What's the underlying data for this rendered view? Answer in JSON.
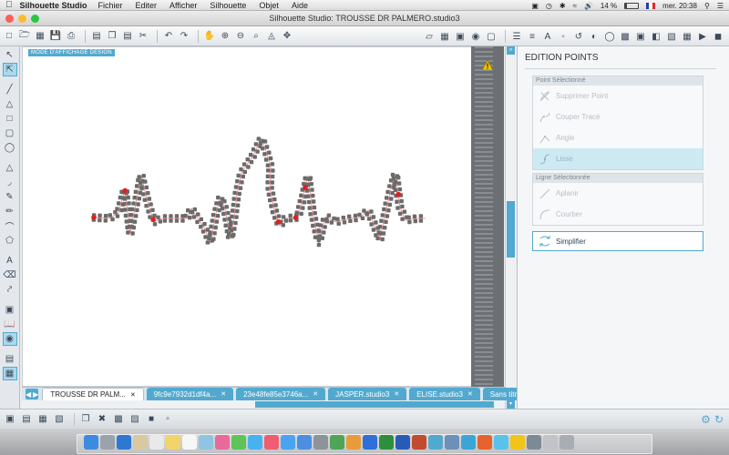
{
  "menubar": {
    "app": "Silhouette Studio",
    "menus": [
      "Fichier",
      "Editer",
      "Afficher",
      "Silhouette",
      "Objet",
      "Aide"
    ],
    "battery": "14 %",
    "clock": "mer. 20:38"
  },
  "window": {
    "title": "Silhouette Studio: TROUSSE DR PALMERO.studio3"
  },
  "canvas": {
    "mode_label": "MODE D'AFFICHAGE DESIGN"
  },
  "panel": {
    "title": "EDITION POINTS",
    "point_section": "Point Sélectionné",
    "point_items": [
      "Supprimer Point",
      "Couper Tracé",
      "Angle",
      "Lisse"
    ],
    "line_section": "Ligne Sélectionnée",
    "line_items": [
      "Aplanir",
      "Courber"
    ],
    "simplify": "Simplifier"
  },
  "tabs": [
    {
      "label": "TROUSSE DR PALM...",
      "active": true
    },
    {
      "label": "9fc9e7932d1df4a...",
      "active": false
    },
    {
      "label": "23e48fe85e3746a...",
      "active": false
    },
    {
      "label": "JASPER.studio3",
      "active": false
    },
    {
      "label": "ELISE.studio3",
      "active": false
    },
    {
      "label": "Sans titre-5.s",
      "active": false
    }
  ],
  "colors": {
    "accent": "#52a9cf",
    "node": "#6b6b6b",
    "selected_node": "#e02020",
    "path": "#f08080"
  }
}
